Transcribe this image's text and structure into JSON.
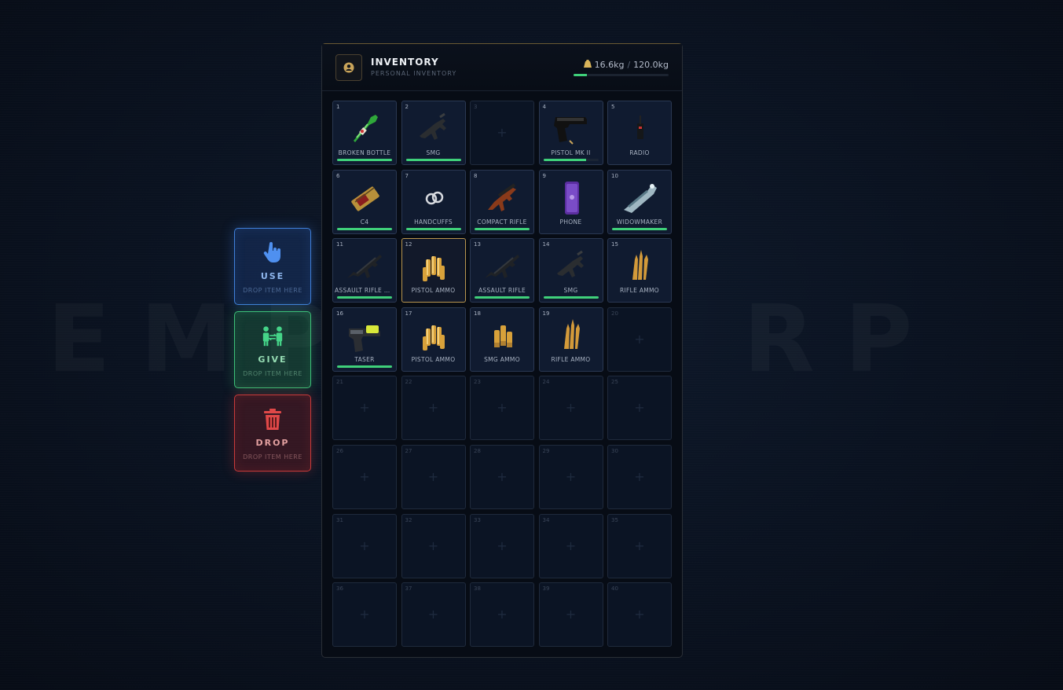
{
  "watermark": "EMPI RE RP",
  "actions": {
    "use": {
      "label": "USE",
      "sub": "DROP ITEM HERE",
      "icon": "pointer-hand-icon"
    },
    "give": {
      "label": "GIVE",
      "sub": "DROP ITEM HERE",
      "icon": "people-exchange-icon"
    },
    "drop": {
      "label": "DROP",
      "sub": "DROP ITEM HERE",
      "icon": "trash-icon"
    }
  },
  "inventory": {
    "title": "INVENTORY",
    "subtitle": "PERSONAL INVENTORY",
    "weight_current": "16.6kg",
    "weight_separator": "/",
    "weight_max": "120.0kg",
    "weight_fraction": 0.138
  },
  "slots": [
    {
      "num": "1",
      "name": "BROKEN BOTTLE",
      "icon": "bottle",
      "durability": 1.0
    },
    {
      "num": "2",
      "name": "SMG",
      "icon": "smg",
      "durability": 1.0
    },
    {
      "num": "3",
      "name": "",
      "icon": "",
      "durability": null
    },
    {
      "num": "4",
      "name": "PISTOL MK II",
      "icon": "pistol",
      "durability": 0.78
    },
    {
      "num": "5",
      "name": "RADIO",
      "icon": "radio",
      "durability": null
    },
    {
      "num": "6",
      "name": "C4",
      "icon": "c4",
      "durability": 1.0
    },
    {
      "num": "7",
      "name": "HANDCUFFS",
      "icon": "handcuffs",
      "durability": 1.0
    },
    {
      "num": "8",
      "name": "COMPACT RIFLE",
      "icon": "compactrifle",
      "durability": 1.0
    },
    {
      "num": "9",
      "name": "PHONE",
      "icon": "phone",
      "durability": null
    },
    {
      "num": "10",
      "name": "WIDOWMAKER",
      "icon": "widowmaker",
      "durability": 1.0
    },
    {
      "num": "11",
      "name": "ASSAULT RIFLE M...",
      "icon": "rifle",
      "durability": 1.0
    },
    {
      "num": "12",
      "name": "PISTOL AMMO",
      "icon": "pistolammo",
      "durability": null,
      "selected": true
    },
    {
      "num": "13",
      "name": "ASSAULT RIFLE",
      "icon": "rifle",
      "durability": 1.0
    },
    {
      "num": "14",
      "name": "SMG",
      "icon": "smg",
      "durability": 1.0
    },
    {
      "num": "15",
      "name": "RIFLE AMMO",
      "icon": "rifleammo",
      "durability": null
    },
    {
      "num": "16",
      "name": "TASER",
      "icon": "taser",
      "durability": 1.0
    },
    {
      "num": "17",
      "name": "PISTOL AMMO",
      "icon": "pistolammo",
      "durability": null
    },
    {
      "num": "18",
      "name": "SMG AMMO",
      "icon": "smgammo",
      "durability": null
    },
    {
      "num": "19",
      "name": "RIFLE AMMO",
      "icon": "rifleammo",
      "durability": null
    },
    {
      "num": "20",
      "name": "",
      "icon": "",
      "durability": null
    },
    {
      "num": "21",
      "name": "",
      "icon": "",
      "durability": null
    },
    {
      "num": "22",
      "name": "",
      "icon": "",
      "durability": null
    },
    {
      "num": "23",
      "name": "",
      "icon": "",
      "durability": null
    },
    {
      "num": "24",
      "name": "",
      "icon": "",
      "durability": null
    },
    {
      "num": "25",
      "name": "",
      "icon": "",
      "durability": null
    },
    {
      "num": "26",
      "name": "",
      "icon": "",
      "durability": null
    },
    {
      "num": "27",
      "name": "",
      "icon": "",
      "durability": null
    },
    {
      "num": "28",
      "name": "",
      "icon": "",
      "durability": null
    },
    {
      "num": "29",
      "name": "",
      "icon": "",
      "durability": null
    },
    {
      "num": "30",
      "name": "",
      "icon": "",
      "durability": null
    },
    {
      "num": "31",
      "name": "",
      "icon": "",
      "durability": null
    },
    {
      "num": "32",
      "name": "",
      "icon": "",
      "durability": null
    },
    {
      "num": "33",
      "name": "",
      "icon": "",
      "durability": null
    },
    {
      "num": "34",
      "name": "",
      "icon": "",
      "durability": null
    },
    {
      "num": "35",
      "name": "",
      "icon": "",
      "durability": null
    },
    {
      "num": "36",
      "name": "",
      "icon": "",
      "durability": null
    },
    {
      "num": "37",
      "name": "",
      "icon": "",
      "durability": null
    },
    {
      "num": "38",
      "name": "",
      "icon": "",
      "durability": null
    },
    {
      "num": "39",
      "name": "",
      "icon": "",
      "durability": null
    },
    {
      "num": "40",
      "name": "",
      "icon": "",
      "durability": null
    }
  ]
}
